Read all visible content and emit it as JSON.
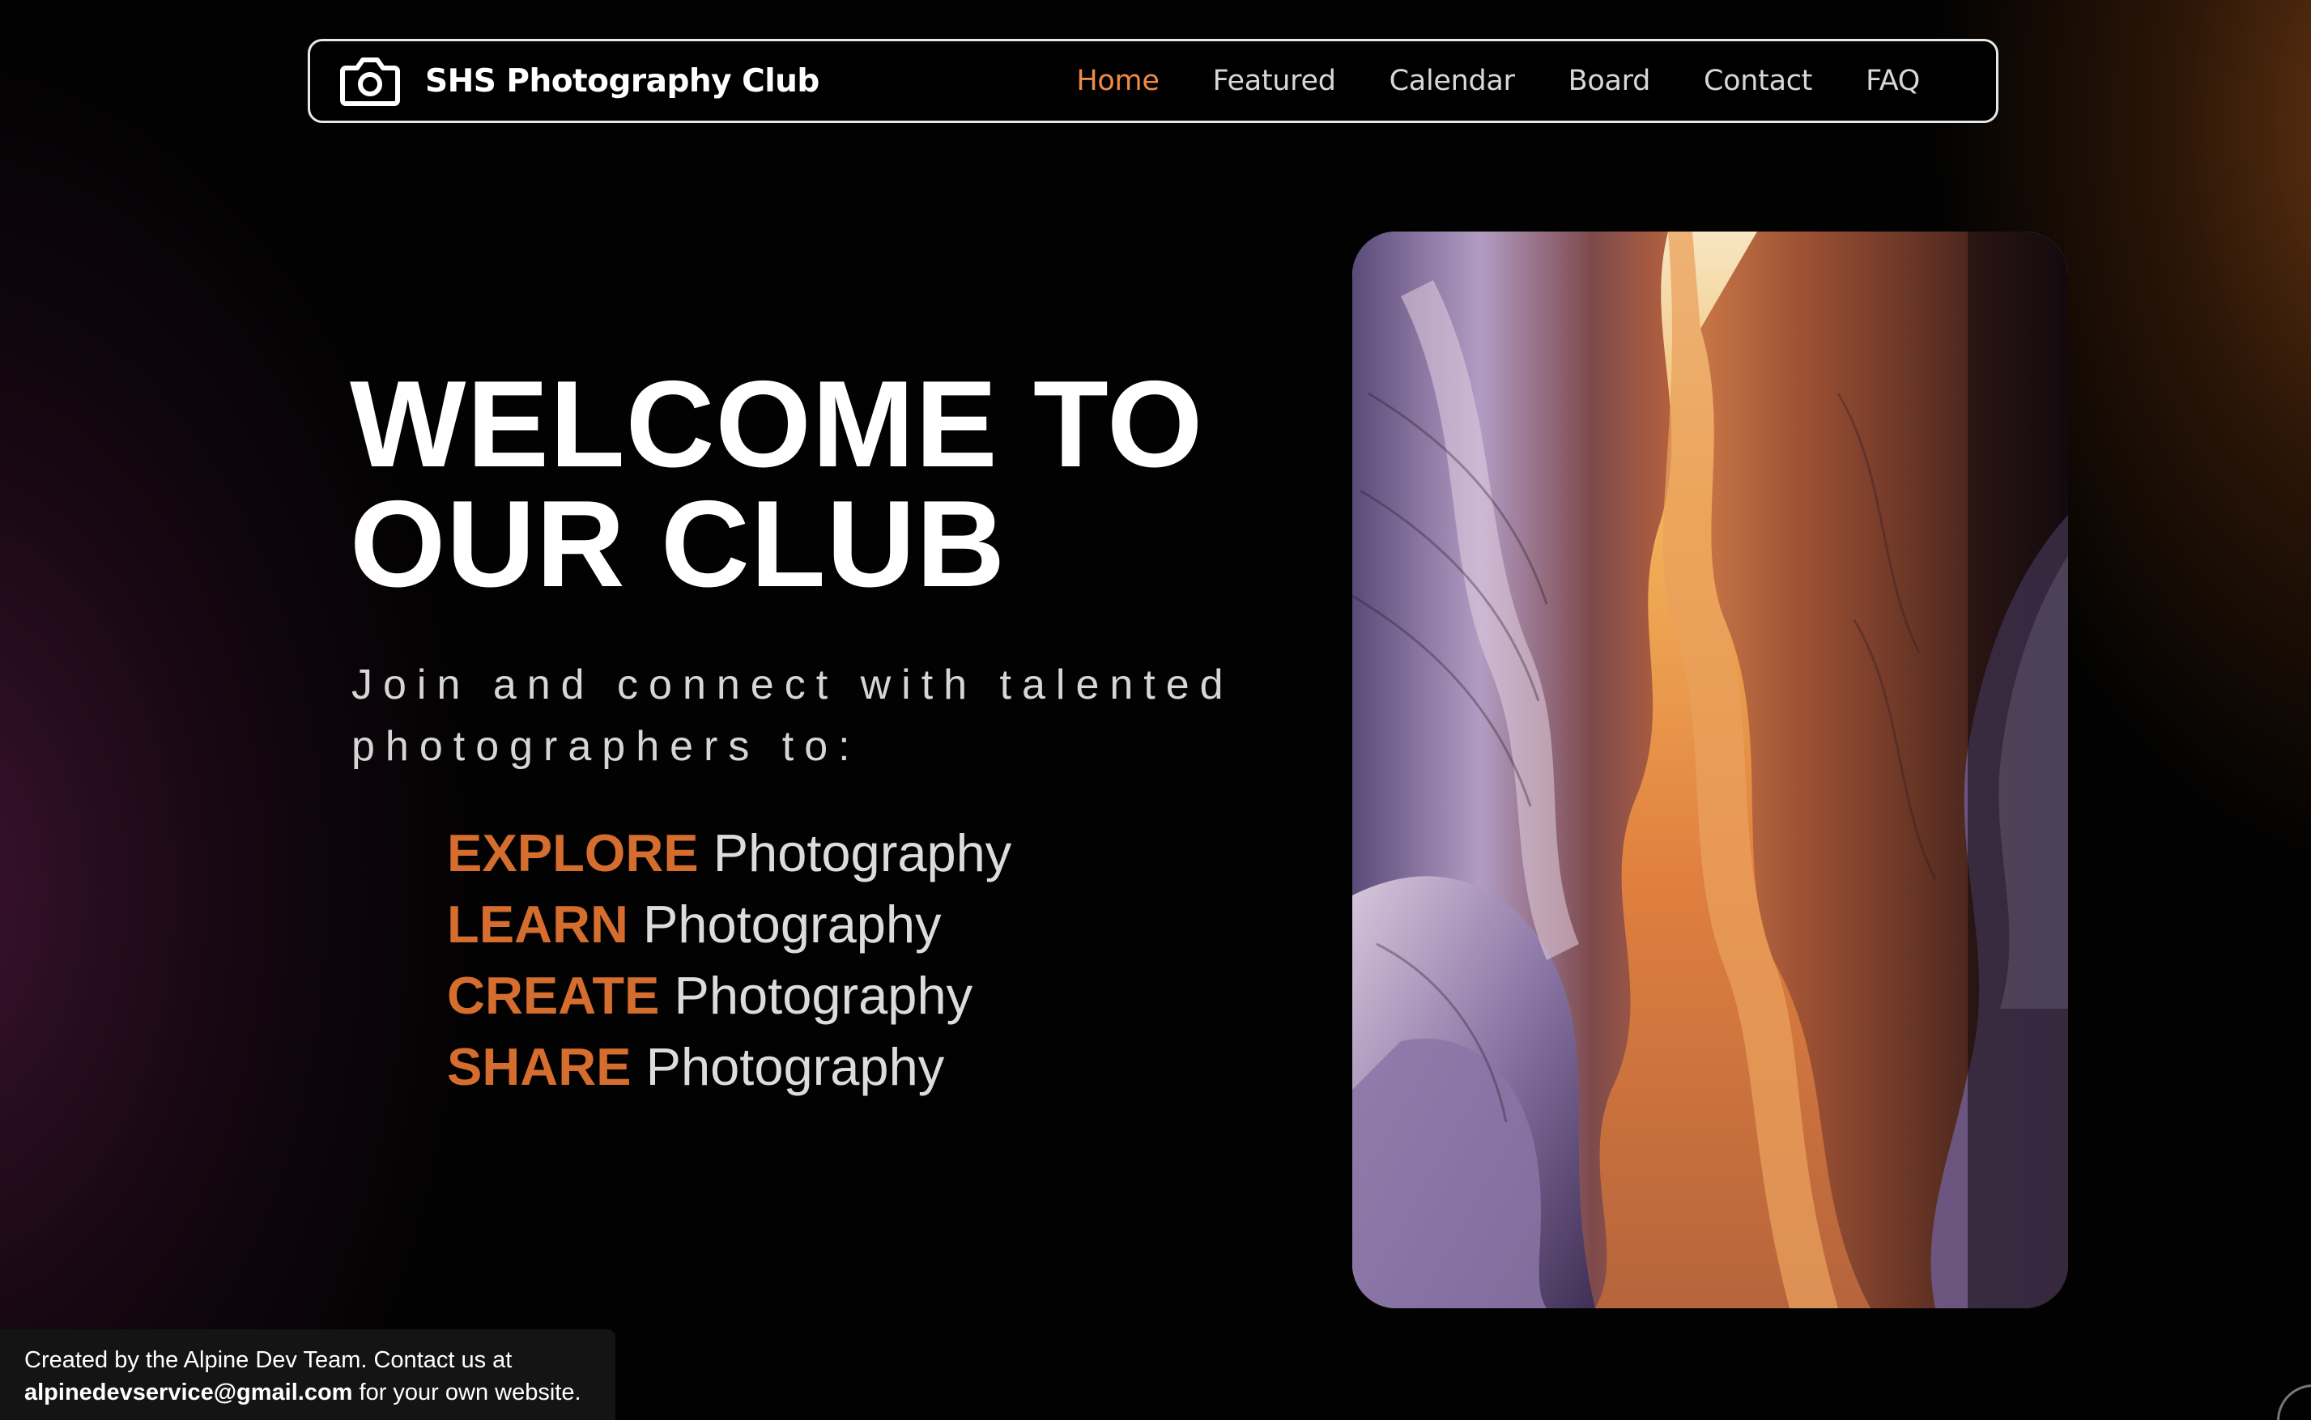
{
  "navbar": {
    "brand_name": "SHS Photography Club",
    "brand_icon": "camera-icon",
    "links": [
      {
        "label": "Home",
        "active": true
      },
      {
        "label": "Featured",
        "active": false
      },
      {
        "label": "Calendar",
        "active": false
      },
      {
        "label": "Board",
        "active": false
      },
      {
        "label": "Contact",
        "active": false
      },
      {
        "label": "FAQ",
        "active": false
      }
    ]
  },
  "hero": {
    "title_line1": "WELCOME TO",
    "title_line2": "OUR CLUB",
    "subtitle_line1": "Join and connect with talented",
    "subtitle_line2": "photographers to:",
    "list": [
      {
        "verb": "EXPLORE",
        "rest": "Photography"
      },
      {
        "verb": "LEARN",
        "rest": "Photography"
      },
      {
        "verb": "CREATE",
        "rest": "Photography"
      },
      {
        "verb": "SHARE",
        "rest": "Photography"
      }
    ]
  },
  "credit": {
    "line1": "Created by the Alpine Dev Team. Contact us at",
    "email": "alpinedevservice@gmail.com",
    "line2_rest": " for your own website."
  },
  "colors": {
    "accent": "#ee8a45",
    "verb": "#d56d2e",
    "nav_border": "#e8e8e8"
  }
}
